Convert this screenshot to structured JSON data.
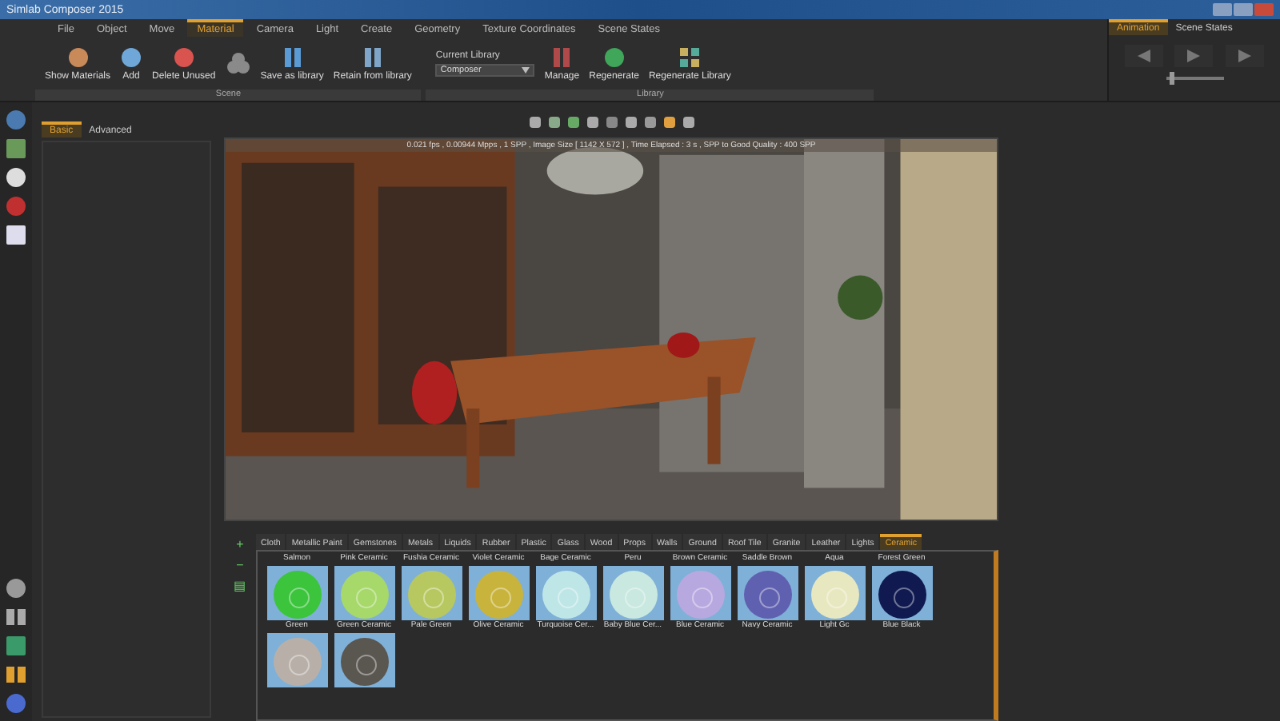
{
  "window": {
    "title": "Simlab Composer 2015"
  },
  "menu_tabs": [
    {
      "label": "File",
      "selected": false
    },
    {
      "label": "Object",
      "selected": false
    },
    {
      "label": "Move",
      "selected": false
    },
    {
      "label": "Material",
      "selected": true
    },
    {
      "label": "Camera",
      "selected": false
    },
    {
      "label": "Light",
      "selected": false
    },
    {
      "label": "Create",
      "selected": false
    },
    {
      "label": "Geometry",
      "selected": false
    },
    {
      "label": "Texture Coordinates",
      "selected": false
    },
    {
      "label": "Scene States",
      "selected": false
    }
  ],
  "ribbon_groups": [
    {
      "label": "Scene",
      "items": [
        {
          "kind": "labeled",
          "label": "Show Materials"
        },
        {
          "kind": "labeled",
          "label": "Add"
        },
        {
          "kind": "labeled",
          "label": "Delete Unused"
        },
        {
          "kind": "icon"
        },
        {
          "kind": "labeled",
          "label": "Save as library"
        },
        {
          "kind": "labeled",
          "label": "Retain from library"
        }
      ]
    },
    {
      "label": "Library",
      "library_label": "Current Library",
      "library_value": "Composer",
      "items": [
        {
          "kind": "labeled",
          "label": "Manage"
        },
        {
          "kind": "labeled",
          "label": "Regenerate"
        },
        {
          "kind": "labeled",
          "label": "Regenerate Library"
        }
      ]
    }
  ],
  "side_panel": {
    "tabs": [
      {
        "label": "Animation",
        "selected": true
      },
      {
        "label": "Scene States",
        "selected": false
      }
    ],
    "timeline": {
      "level": 0.1
    }
  },
  "properties_panel": {
    "tabs": [
      {
        "label": "Basic",
        "selected": true
      },
      {
        "label": "Advanced",
        "selected": false
      }
    ]
  },
  "viewport": {
    "status": "0.021 fps , 0.00944 Mpps , 1 SPP , Image Size [ 1142 X 572 ] , Time Elapsed : 3 s , SPP to Good Quality : 400 SPP"
  },
  "materials": {
    "side_buttons": [
      "+",
      "−",
      "▤"
    ],
    "tabs": [
      {
        "label": "Cloth",
        "selected": false
      },
      {
        "label": "Metallic Paint",
        "selected": false
      },
      {
        "label": "Gemstones",
        "selected": false
      },
      {
        "label": "Metals",
        "selected": false
      },
      {
        "label": "Liquids",
        "selected": false
      },
      {
        "label": "Rubber",
        "selected": false
      },
      {
        "label": "Plastic",
        "selected": false
      },
      {
        "label": "Glass",
        "selected": false
      },
      {
        "label": "Wood",
        "selected": false
      },
      {
        "label": "Props",
        "selected": false
      },
      {
        "label": "Walls",
        "selected": false
      },
      {
        "label": "Ground",
        "selected": false
      },
      {
        "label": "Roof Tile",
        "selected": false
      },
      {
        "label": "Granite",
        "selected": false
      },
      {
        "label": "Leather",
        "selected": false
      },
      {
        "label": "Lights",
        "selected": false
      },
      {
        "label": "Ceramic",
        "selected": true
      }
    ],
    "cut_row_labels": [
      "Salmon",
      "Pink Ceramic",
      "Fushia Ceramic",
      "Violet Ceramic",
      "Bage Ceramic",
      "Peru",
      "Brown Ceramic",
      "Saddle Brown",
      "Aqua",
      "Forest Green"
    ],
    "swatches": [
      {
        "label": "Green",
        "color": "#3cc43c"
      },
      {
        "label": "Green Ceramic",
        "color": "#a6d86a"
      },
      {
        "label": "Pale Green",
        "color": "#b8c860"
      },
      {
        "label": "Olive Ceramic",
        "color": "#c8b43c"
      },
      {
        "label": "Turquoise Cer...",
        "color": "#bfe6e6"
      },
      {
        "label": "Baby Blue Cer...",
        "color": "#c8e8e0"
      },
      {
        "label": "Blue Ceramic",
        "color": "#b8a8e0"
      },
      {
        "label": "Navy Ceramic",
        "color": "#6060b0"
      },
      {
        "label": "Light Gc",
        "color": "#e8e8c0"
      },
      {
        "label": "Blue Black",
        "color": "#101a50"
      },
      {
        "color": "#b8b0a8"
      },
      {
        "color": "#5a5650"
      }
    ]
  }
}
